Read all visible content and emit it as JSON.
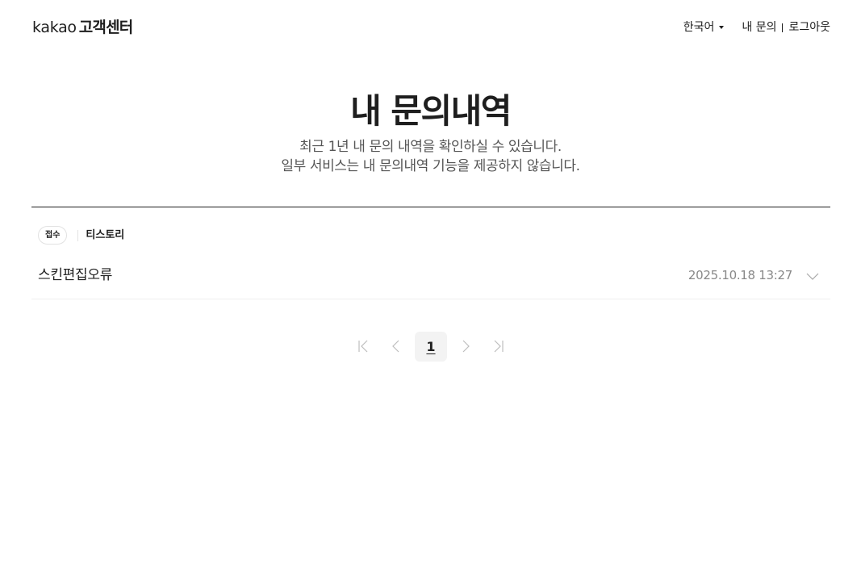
{
  "header": {
    "brand": "kakao",
    "service": "고객센터",
    "language": "한국어",
    "my_inquiries": "내 문의",
    "logout": "로그아웃"
  },
  "page": {
    "title": "내 문의내역",
    "subtitle_line1": "최근 1년 내 문의 내역을 확인하실 수 있습니다.",
    "subtitle_line2": "일부 서비스는 내 문의내역 기능을 제공하지 않습니다."
  },
  "inquiries": [
    {
      "status": "접수",
      "service": "티스토리",
      "title": "스킨편집오류",
      "datetime": "2025.10.18 13:27"
    }
  ],
  "pagination": {
    "current_page": "1",
    "icons": [
      "first-page-icon",
      "prev-page-icon",
      "next-page-icon",
      "last-page-icon"
    ]
  },
  "colors": {
    "text": "#1e1e1e",
    "subtext": "#555555",
    "date": "#888888",
    "divider": "#1e1e1e",
    "row_border": "#efefef",
    "badge_border": "#e2e2e2",
    "current_page_bg": "#f3f3f3",
    "disabled_icon": "#bdbdbd"
  }
}
